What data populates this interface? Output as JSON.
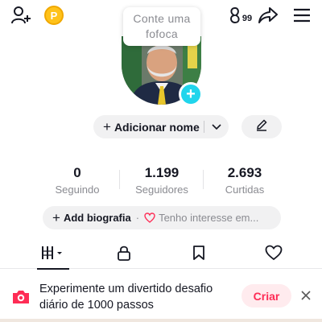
{
  "topbar": {
    "coin_label": "P",
    "views_label": "99",
    "icons": [
      "add-friend-icon",
      "coin-icon",
      "profile-views-icon",
      "share-icon",
      "menu-icon"
    ]
  },
  "bubble": {
    "text_line1": "Conte uma",
    "text_line2": "fofoca"
  },
  "profile": {
    "add_name_label": "Adicionar nome",
    "avatar_desc_colors": {
      "accent": "#20d5ec"
    }
  },
  "stats": [
    {
      "value": "0",
      "label": "Seguindo"
    },
    {
      "value": "1.199",
      "label": "Seguidores"
    },
    {
      "value": "2.693",
      "label": "Curtidas"
    }
  ],
  "bio": {
    "add_bio_label": "Add biografia",
    "separator": "·",
    "interest_label": "Tenho interesse em..."
  },
  "tabs": [
    {
      "name": "videos",
      "icon": "grid-icon",
      "active": true
    },
    {
      "name": "private",
      "icon": "lock-icon"
    },
    {
      "name": "favorites",
      "icon": "bookmark-icon"
    },
    {
      "name": "liked",
      "icon": "heart-icon"
    }
  ],
  "banner": {
    "text": "Experimente um divertido desafio diário de 1000 passos",
    "cta_label": "Criar",
    "icon": "camera-icon"
  },
  "colors": {
    "brand_red": "#fe2c55",
    "accent_cyan": "#20d5ec",
    "coin": "#ffc21a"
  }
}
